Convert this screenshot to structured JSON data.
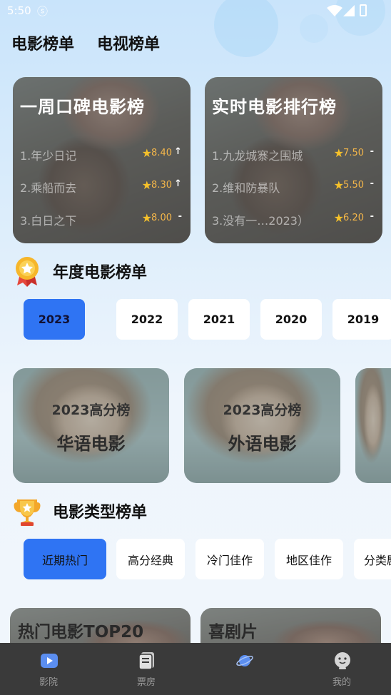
{
  "status_bar": {
    "time": "5:50",
    "notification_glyph": "ⓢ"
  },
  "top_tabs": [
    "电影榜单",
    "电视榜单"
  ],
  "rank_cards": [
    {
      "title": "一周口碑电影榜",
      "rows": [
        {
          "name": "1.年少日记",
          "score": "8.40",
          "trend": "↑"
        },
        {
          "name": "2.乘船而去",
          "score": "8.30",
          "trend": "↑"
        },
        {
          "name": "3.白日之下",
          "score": "8.00",
          "trend": "-"
        }
      ]
    },
    {
      "title": "实时电影排行榜",
      "rows": [
        {
          "name": "1.九龙城寨之围城",
          "score": "7.50",
          "trend": "-"
        },
        {
          "name": "2.维和防暴队",
          "score": "5.50",
          "trend": "-"
        },
        {
          "name": "3.没有一…2023）",
          "score": "6.20",
          "trend": "-"
        }
      ]
    }
  ],
  "annual_section": {
    "title": "年度电影榜单",
    "years": [
      "2023",
      "2022",
      "2021",
      "2020",
      "2019"
    ],
    "selected_year": "2023",
    "cards": [
      {
        "subtitle": "2023高分榜",
        "title": "华语电影"
      },
      {
        "subtitle": "2023高分榜",
        "title": "外语电影"
      }
    ]
  },
  "genre_section": {
    "title": "电影类型榜单",
    "chips": [
      "近期热门",
      "高分经典",
      "冷门佳作",
      "地区佳作",
      "分类剧"
    ],
    "selected_chip": "近期热门",
    "cards": [
      {
        "title": "热门电影TOP20"
      },
      {
        "title": "喜剧片"
      }
    ]
  },
  "bottom_nav": [
    {
      "label": "影院",
      "icon": "cinema-play-icon"
    },
    {
      "label": "票房",
      "icon": "box-office-icon"
    },
    {
      "label": "",
      "icon": "planet-icon"
    },
    {
      "label": "我的",
      "icon": "profile-face-icon"
    }
  ],
  "colors": {
    "accent": "#2f74f3",
    "star": "#f6c12a",
    "score": "#f5b74a",
    "nav_bg": "#3a3a3a"
  }
}
